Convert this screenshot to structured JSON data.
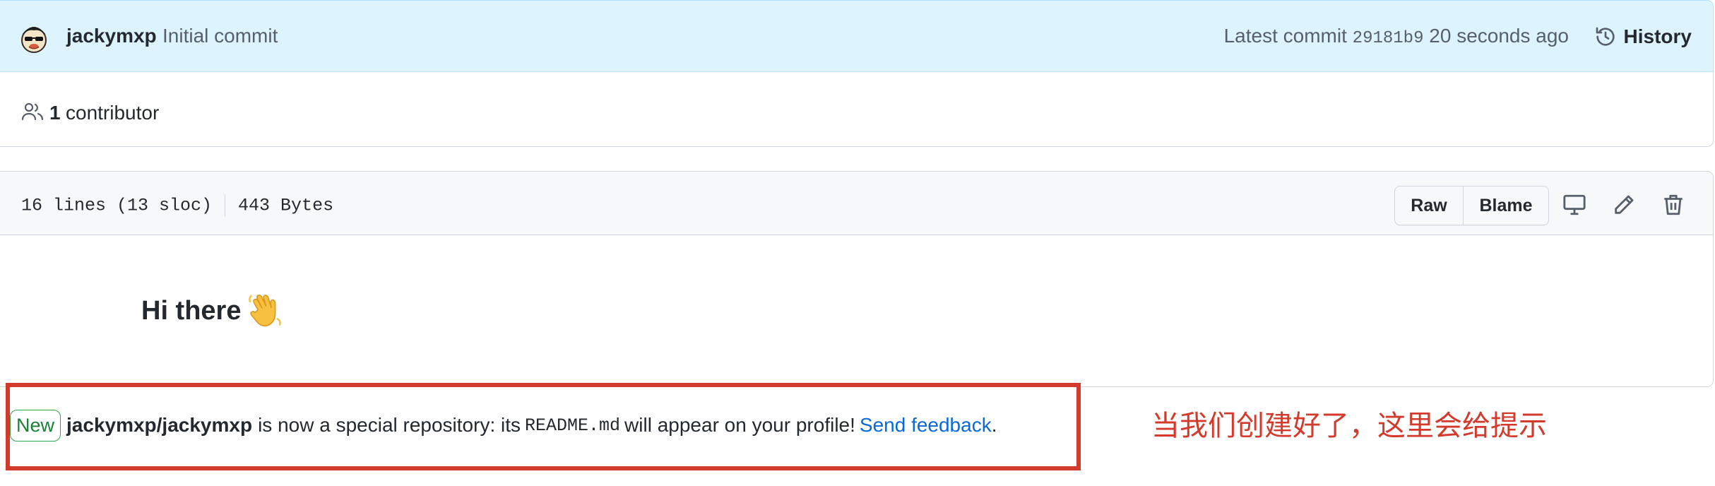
{
  "commit": {
    "author": "jackymxp",
    "message": "Initial commit",
    "latest_label": "Latest commit",
    "sha": "29181b9",
    "time": "20 seconds ago",
    "history_label": "History"
  },
  "contributors": {
    "count": "1",
    "label": "contributor"
  },
  "file": {
    "lines": "16 lines (13 sloc)",
    "size": "443 Bytes",
    "raw_label": "Raw",
    "blame_label": "Blame"
  },
  "readme": {
    "heading": "Hi there"
  },
  "notice": {
    "badge": "New",
    "repo": "jackymxp/jackymxp",
    "text1": "is now a special repository: its",
    "code": "README.md",
    "text2": "will appear on your profile!",
    "link": "Send feedback",
    "end": "."
  },
  "annotation": "当我们创建好了，这里会给提示",
  "colors": {
    "accent_link": "#0969da",
    "annotation_red": "#d33a2c",
    "badge_green": "#1a7f37"
  },
  "icons": [
    "avatar",
    "history-icon",
    "people-icon",
    "desktop-icon",
    "pencil-icon",
    "trash-icon",
    "waving-hand-icon"
  ]
}
